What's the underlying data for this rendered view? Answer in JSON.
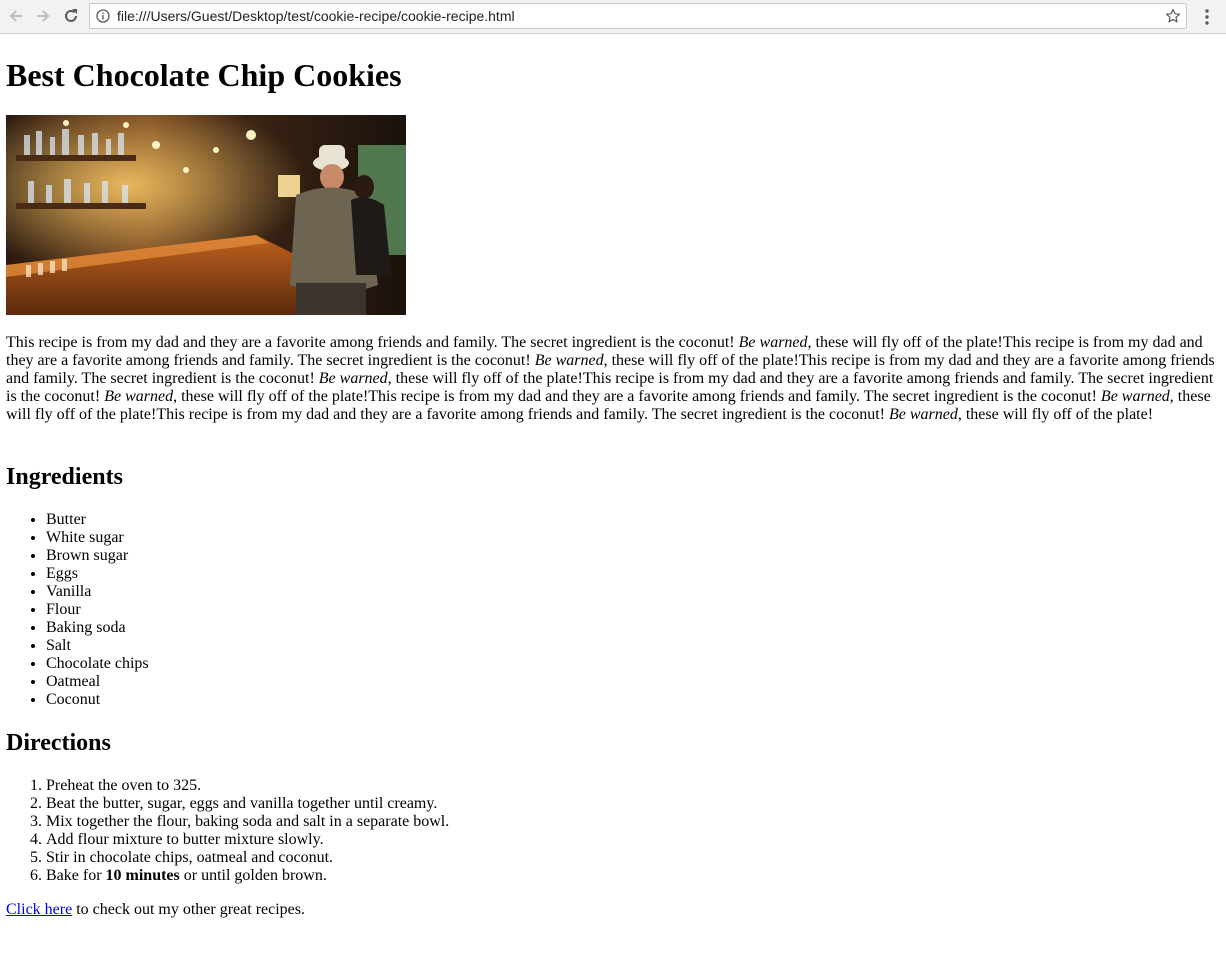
{
  "browser": {
    "url": "file:///Users/Guest/Desktop/test/cookie-recipe/cookie-recipe.html",
    "icons": [
      "back-arrow-icon",
      "forward-arrow-icon",
      "reload-icon",
      "info-icon",
      "star-icon",
      "more-vert-icon"
    ]
  },
  "page": {
    "title": "Best Chocolate Chip Cookies",
    "intro": {
      "repeat_count": 6,
      "before": "This recipe is from my dad and they are a favorite among friends and family. The secret ingredient is the coconut! ",
      "emphasis": "Be warned",
      "after": ", these will fly off of the plate!"
    },
    "ingredients": {
      "heading": "Ingredients",
      "items": [
        "Butter",
        "White sugar",
        "Brown sugar",
        "Eggs",
        "Vanilla",
        "Flour",
        "Baking soda",
        "Salt",
        "Chocolate chips",
        "Oatmeal",
        "Coconut"
      ]
    },
    "directions": {
      "heading": "Directions",
      "steps": [
        {
          "text": "Preheat the oven to 325."
        },
        {
          "text": "Beat the butter, sugar, eggs and vanilla together until creamy."
        },
        {
          "text": "Mix together the flour, baking soda and salt in a separate bowl."
        },
        {
          "text": "Add flour mixture to butter mixture slowly."
        },
        {
          "text": "Stir in chocolate chips, oatmeal and coconut."
        },
        {
          "before": "Bake for ",
          "bold": "10 minutes",
          "after": " or until golden brown."
        }
      ]
    },
    "outro": {
      "link": "Click here",
      "text": " to check out my other great recipes."
    }
  }
}
